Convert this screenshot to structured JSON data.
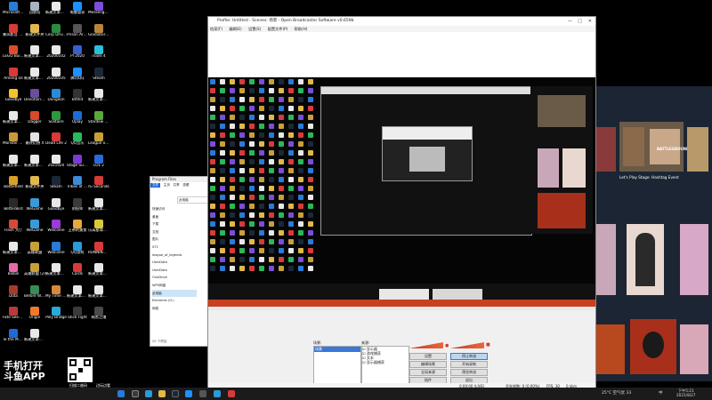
{
  "desktop": {
    "icons": [
      {
        "label": "Microsoft Edge",
        "color": "#2a7bd8"
      },
      {
        "label": "回收站",
        "color": "#aab4c0"
      },
      {
        "label": "新建文本文档 (4).txt",
        "color": "#e8e8e8"
      },
      {
        "label": "电脑管家",
        "color": "#1e90ff"
      },
      {
        "label": "Messenger Mixer",
        "color": "#7b4dd8"
      },
      {
        "label": "暴风影音 Undi",
        "color": "#d83a3a"
      },
      {
        "label": "新建文件夹",
        "color": "#e2b84a"
      },
      {
        "label": "Corp Driver",
        "color": "#2b8a3e"
      },
      {
        "label": "Prison Architect",
        "color": "#555"
      },
      {
        "label": "Gladiator Guild",
        "color": "#b8863b"
      },
      {
        "label": "LEGO Builder",
        "color": "#e04c2a"
      },
      {
        "label": "新建文本文档",
        "color": "#e8e8e8"
      },
      {
        "label": "20200102",
        "color": "#e8e8e8"
      },
      {
        "label": "PI 2020",
        "color": "#3a5fcd"
      },
      {
        "label": "iTools 4",
        "color": "#2ac1d8"
      },
      {
        "label": "Among Us",
        "color": "#d83a3a"
      },
      {
        "label": "新建文本文档 (5).txt",
        "color": "#e8e8e8"
      },
      {
        "label": "20200105",
        "color": "#e8e8e8"
      },
      {
        "label": "腾讯QQ",
        "color": "#1e90ff"
      },
      {
        "label": "Steam",
        "color": "#1b2838"
      },
      {
        "label": "Goodbye",
        "color": "#f5c22a"
      },
      {
        "label": "Devotion Valley",
        "color": "#6b4d9a"
      },
      {
        "label": "Dungeon",
        "color": "#2a8ad8"
      },
      {
        "label": "BitVid",
        "color": "#333"
      },
      {
        "label": "新建文本文档",
        "color": "#e8e8e8"
      },
      {
        "label": "新建文本文档",
        "color": "#e8e8e8"
      },
      {
        "label": "Dagger",
        "color": "#d84a2a"
      },
      {
        "label": "Solitaire",
        "color": "#2a9a3e"
      },
      {
        "label": "Uplay",
        "color": "#1e6ad8"
      },
      {
        "label": "Stardew Demo",
        "color": "#5aa83a"
      },
      {
        "label": "Monster Hunter",
        "color": "#c89a3a"
      },
      {
        "label": "最终幻想 X",
        "color": "#e2e2e2"
      },
      {
        "label": "Dead Life 2",
        "color": "#d83a3a"
      },
      {
        "label": "QQ音乐",
        "color": "#2ab85a"
      },
      {
        "label": "League of Legends",
        "color": "#c8a03a"
      },
      {
        "label": "新建文本文档 (2).txt",
        "color": "#e8e8e8"
      },
      {
        "label": "新建文本文档 (3).txt",
        "color": "#e8e8e8"
      },
      {
        "label": "2021020",
        "color": "#e8e8e8"
      },
      {
        "label": "Stage Survival",
        "color": "#7a3ad8"
      },
      {
        "label": "LOL 2",
        "color": "#2a6ad8"
      },
      {
        "label": "Battlefield",
        "color": "#d8a02a"
      },
      {
        "label": "新建文件夹",
        "color": "#e2b84a"
      },
      {
        "label": "Steam",
        "color": "#1b2838"
      },
      {
        "label": "Tribes of Midgard",
        "color": "#3a8ad8"
      },
      {
        "label": "IG Seconds",
        "color": "#d83a3a"
      },
      {
        "label": "BetterBird",
        "color": "#2a2a2a"
      },
      {
        "label": "WeGame",
        "color": "#3a9ad8"
      },
      {
        "label": "Goodbye",
        "color": "#e8e8e8"
      },
      {
        "label": "阴阳师",
        "color": "#3a3a3a"
      },
      {
        "label": "新建文本文档",
        "color": "#e8e8e8"
      },
      {
        "label": "Flash 大厅",
        "color": "#d8483a"
      },
      {
        "label": "WeGame",
        "color": "#3a9ad8"
      },
      {
        "label": "Welcome",
        "color": "#9a3ad8"
      },
      {
        "label": "上帝的美食",
        "color": "#e8a83a"
      },
      {
        "label": "乐高星球大战",
        "color": "#d8c83a"
      },
      {
        "label": "新建文本文档",
        "color": "#e8e8e8"
      },
      {
        "label": "英雄联盟",
        "color": "#c8a03a"
      },
      {
        "label": "Welcome",
        "color": "#2a7ad8"
      },
      {
        "label": "QQ游戏",
        "color": "#2a9ad8"
      },
      {
        "label": "RUNNING WITH",
        "color": "#d83a3a"
      },
      {
        "label": "Bilibili",
        "color": "#e86aa8"
      },
      {
        "label": "英雄联盟 (2)",
        "color": "#c8a03a"
      },
      {
        "label": "新建文本文档",
        "color": "#e8e8e8"
      },
      {
        "label": "Cards",
        "color": "#d83a3a"
      },
      {
        "label": "新建文本文档",
        "color": "#e8e8e8"
      },
      {
        "label": "Dota",
        "color": "#a83a2a"
      },
      {
        "label": "Before We Leave",
        "color": "#3a8a5a"
      },
      {
        "label": "My Time At Portia",
        "color": "#d8883a"
      },
      {
        "label": "新建文本文档",
        "color": "#e8e8e8"
      },
      {
        "label": "新建文本文档",
        "color": "#e8e8e8"
      },
      {
        "label": "Fate Seeker",
        "color": "#b83a3a"
      },
      {
        "label": "Origin",
        "color": "#f07a2a"
      },
      {
        "label": "Poly Bridge",
        "color": "#2aa8d8"
      },
      {
        "label": "Stick Fight",
        "color": "#3a3a3a"
      },
      {
        "label": "暗黑之魂",
        "color": "#4a4a4a"
      },
      {
        "label": "To the Moon",
        "color": "#1e6ad8"
      },
      {
        "label": "新建文本文档",
        "color": "#e8e8e8"
      }
    ]
  },
  "obs": {
    "title": "Profile: Untitled - Scenes: 场景 - Open Broadcaster Software v0.659b",
    "menu": [
      "档案(F)",
      "编辑(E)",
      "设置(S)",
      "配置文件(P)",
      "帮助(H)"
    ],
    "scenes_label": "场景:",
    "scenes": [
      "场景"
    ],
    "sources_label": "来源:",
    "sources": [
      "显示器",
      "游戏捕获",
      "文本",
      "显示器捕获"
    ],
    "buttons": {
      "settings": "设置",
      "start_stream": "停止串流",
      "edit_scene": "编辑场景",
      "start_record": "开始录制",
      "global_source": "全局来源",
      "preview": "预览串流",
      "plugins": "插件",
      "exit": "退出"
    },
    "status": {
      "time": "0:00:00 (LIVE)",
      "dropped": "丢失帧数: 0 (0.00%)",
      "fps": "FPS: 30",
      "kbps": "0 kb/s"
    }
  },
  "explorer": {
    "title": "Program Files",
    "ribbon": [
      "文件",
      "主页",
      "共享",
      "查看"
    ],
    "address": "此电脑",
    "nav": [
      "快速访问",
      "桌面",
      "下载",
      "文档",
      "图片",
      "ST2",
      "league_of_legends",
      "UserData",
      "UserData",
      "OneDrive",
      "WPS网盘",
      "此电脑",
      "Elements (G:)",
      "网络"
    ],
    "count": "25 个项目"
  },
  "store": {
    "event": "Let's Play Stage: Hashtag Event",
    "brand": "BATTLEGROUNDS"
  },
  "watermark": {
    "title": "手机打开",
    "brand": "斗鱼APP",
    "sub": "扫描二维码",
    "sub2": "边玩边看"
  },
  "taskbar": {
    "temperature": "25°C 空气优 33",
    "time": "下午5:21",
    "date": "2021/8/27",
    "lang": "中"
  },
  "colors": {
    "desktop_bg": "#000000",
    "obs_bg": "#e8e8e8",
    "store_bg": "#1c2533",
    "taskbar_bg": "#1b1b1b",
    "accent": "#0078d7"
  }
}
